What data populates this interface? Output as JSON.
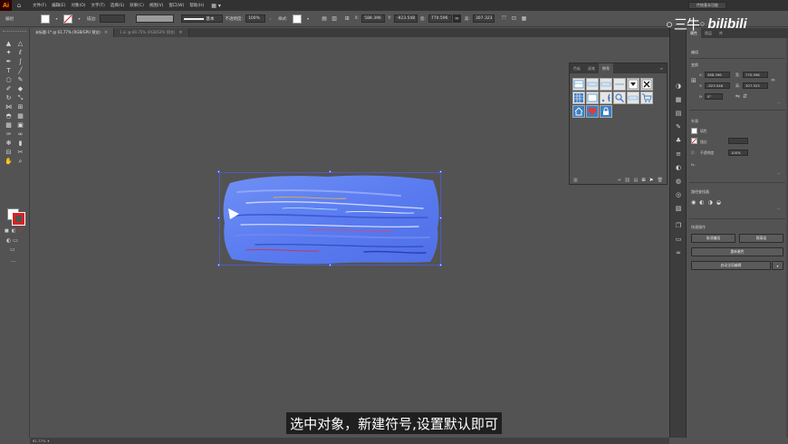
{
  "app": {
    "logo_text": "Ai",
    "menu": [
      "文件(F)",
      "编辑(E)",
      "对象(O)",
      "文字(T)",
      "选择(S)",
      "效果(C)",
      "视图(V)",
      "窗口(W)",
      "帮助(H)"
    ],
    "workspace": "传统基本功能"
  },
  "controlbar": {
    "selection_label": "编组",
    "stroke_label": "描边:",
    "stroke_profile": "基本",
    "opacity_label": "不透明度:",
    "opacity_value": "100%",
    "style_label": "样式:",
    "x_value": "588.396",
    "y_value": "-923.548",
    "w_value": "770.596",
    "h_value": "307.323"
  },
  "tabs": [
    {
      "label": "未标题-1* @ 61.77% (RGB/GPU 预览)",
      "active": true
    },
    {
      "label": "1.ai @ 80.75% (RGB/GPU 预览)",
      "active": false
    }
  ],
  "statusbar": {
    "zoom": "61.77%"
  },
  "symbols_panel": {
    "tabs": [
      "色板",
      "画笔",
      "符号"
    ],
    "active_tab": "符号"
  },
  "properties": {
    "tabs": [
      "属性",
      "图层",
      "库"
    ],
    "selection_type": "编组",
    "transform_title": "变换",
    "x": "588.396",
    "y": "-923.548",
    "w": "770.596",
    "h": "307.323",
    "rotate": "0°",
    "appearance_title": "外观",
    "fill_label": "填色",
    "stroke_label": "描边",
    "opacity_label": "不透明度",
    "opacity_value": "100%",
    "align_title": "路径查找器",
    "quick_actions_title": "快速操作",
    "btn_ungroup": "取消编组",
    "btn_isolate": "隔离组",
    "btn_recolor": "重新着色",
    "btn_arrange": "启动全局编辑"
  },
  "watermark": {
    "text": "三牛",
    "brand": "bilibili"
  },
  "subtitle": "选中对象，新建符号,设置默认即可",
  "colors": {
    "artwork_blue": "#5a7cf0",
    "selection": "#4a60e8",
    "ui_bg": "#535353"
  }
}
